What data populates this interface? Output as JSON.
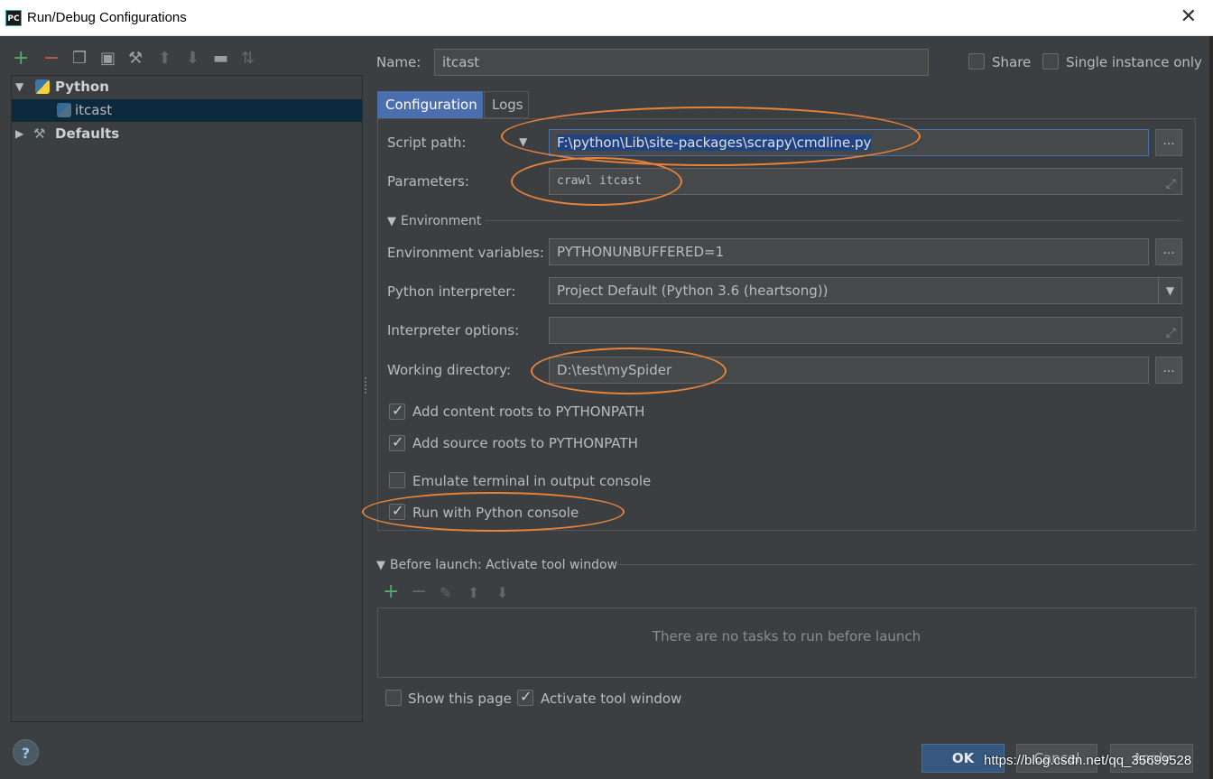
{
  "window": {
    "title": "Run/Debug Configurations",
    "app_icon": "PC",
    "close": "✕"
  },
  "left": {
    "toolbar": [
      "add-icon",
      "remove-icon",
      "copy-icon",
      "save-icon",
      "wrench-icon",
      "arrow-up-icon",
      "arrow-down-icon",
      "folder-icon",
      "sort-icon"
    ],
    "tree": [
      {
        "label": "Python",
        "expanded": true
      },
      {
        "label": "itcast",
        "selected": true
      },
      {
        "label": "Defaults",
        "expanded": false
      }
    ]
  },
  "header": {
    "name_label": "Name:",
    "name_value": "itcast",
    "share_label": "Share",
    "single_instance_label": "Single instance only"
  },
  "tabs": [
    "Configuration",
    "Logs"
  ],
  "config": {
    "script_path_label": "Script path:",
    "script_path_value": "F:\\python\\Lib\\site-packages\\scrapy\\cmdline.py",
    "parameters_label": "Parameters:",
    "parameters_value": "crawl itcast",
    "environment_header": "Environment",
    "env_vars_label": "Environment variables:",
    "env_vars_value": "PYTHONUNBUFFERED=1",
    "interpreter_label": "Python interpreter:",
    "interpreter_value": "Project Default (Python 3.6 (heartsong))",
    "interp_options_label": "Interpreter options:",
    "interp_options_value": "",
    "working_dir_label": "Working directory:",
    "working_dir_value": "D:\\test\\mySpider",
    "checkboxes": [
      {
        "label": "Add content roots to PYTHONPATH",
        "checked": true
      },
      {
        "label": "Add source roots to PYTHONPATH",
        "checked": true
      },
      {
        "label": "Emulate terminal in output console",
        "checked": false
      },
      {
        "label": "Run with Python console",
        "checked": true
      }
    ],
    "browse": "...",
    "dropdown_arrow": "▼"
  },
  "before_launch": {
    "header": "Before launch: Activate tool window",
    "empty_text": "There are no tasks to run before launch",
    "show_page_label": "Show this page",
    "show_page_checked": false,
    "activate_label": "Activate tool window",
    "activate_checked": true
  },
  "footer": {
    "help": "?",
    "ok": "OK",
    "cancel": "Cancel",
    "apply": "Apply",
    "watermark": "https://blog.csdn.net/qq_35699528"
  },
  "colors": {
    "background": "#3c3f41",
    "accent": "#4b6eaf",
    "highlight": "#e8823a",
    "selection": "#0d293e"
  }
}
